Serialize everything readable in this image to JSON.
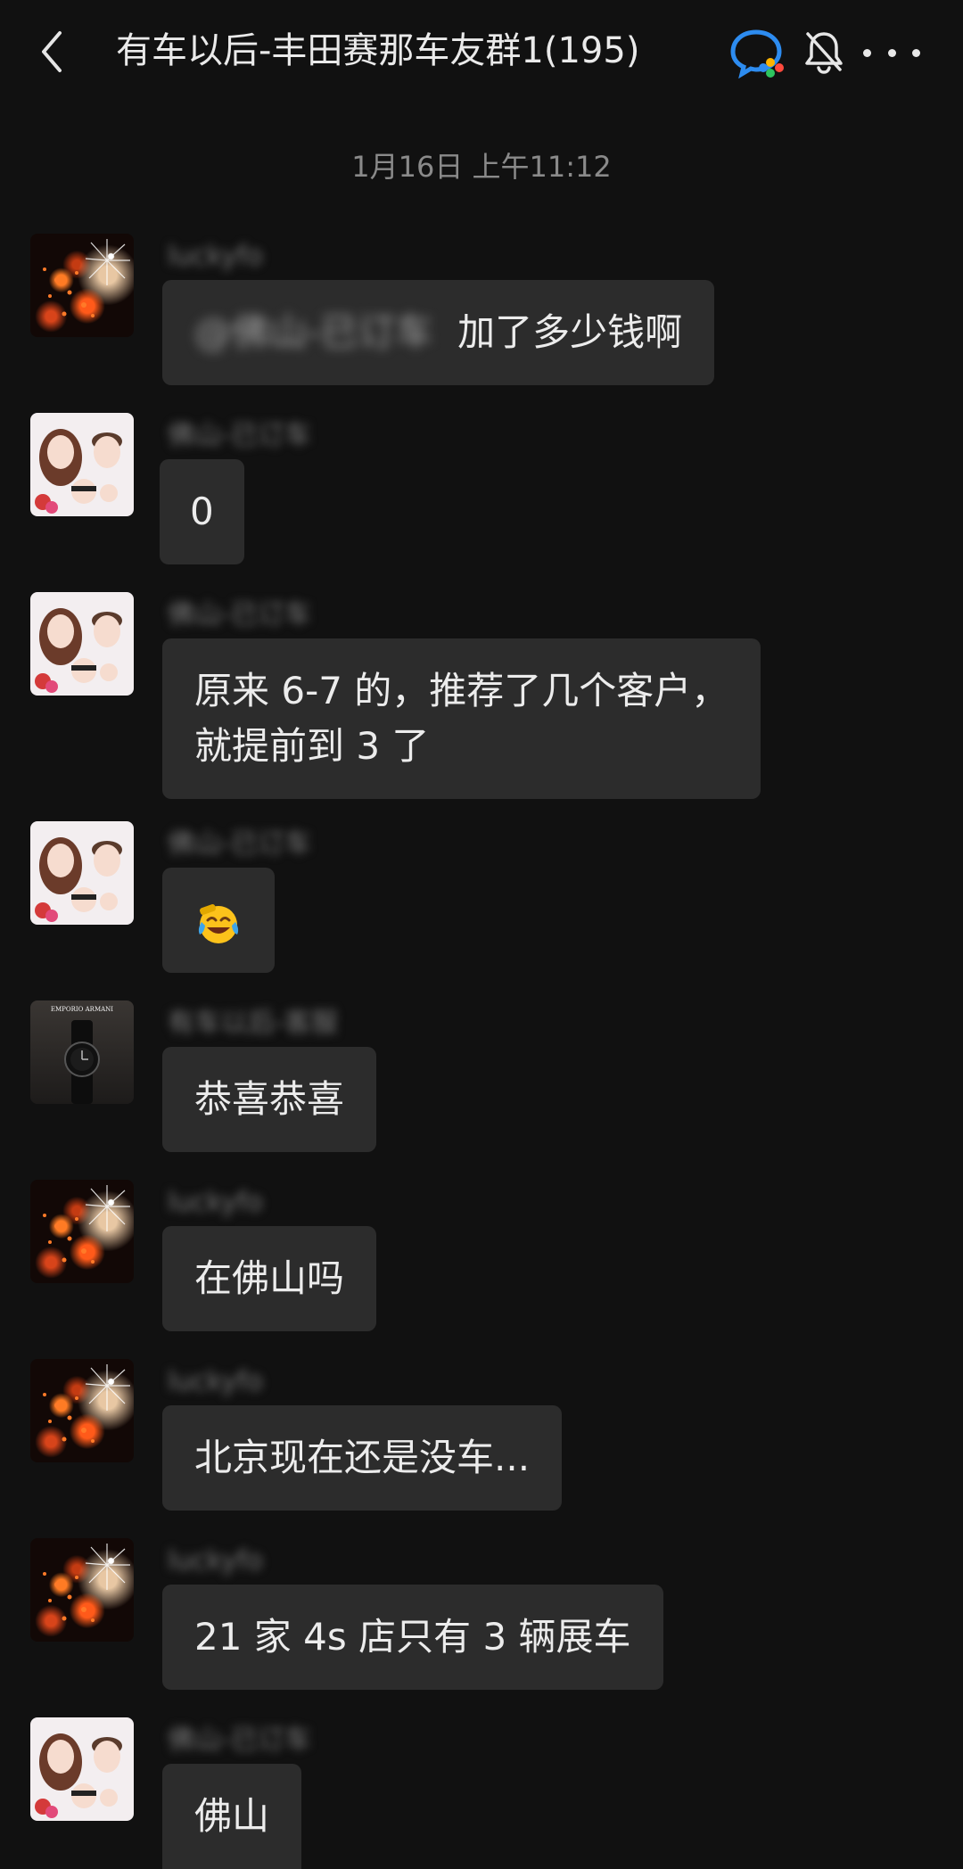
{
  "header": {
    "back_icon": "chevron-left-icon",
    "title": "有车以后-丰田赛那车友群1(195)",
    "corp_icon": "enterprise-chat-icon",
    "mute_icon": "bell-off-icon",
    "more_icon": "more-dots-icon"
  },
  "divider": {
    "time": "1月16日 上午11:12"
  },
  "messages": [
    {
      "sender": "luckyfo",
      "avatar": "fireworks-avatar",
      "mention": "@佛山-已订车",
      "text": "加了多少钱啊"
    },
    {
      "sender": "佛山-已订车",
      "avatar": "couple-avatar",
      "text": "0"
    },
    {
      "sender": "佛山-已订车",
      "avatar": "couple-avatar",
      "text_line1": "原来 6-7 的，推荐了几个客户，",
      "text_line2": "就提前到 3 了"
    },
    {
      "sender": "佛山-已订车",
      "avatar": "couple-avatar",
      "emoji": "face-with-tears-of-joy"
    },
    {
      "sender": "有车以后-客服",
      "avatar": "watch-avatar",
      "text": "恭喜恭喜"
    },
    {
      "sender": "luckyfo",
      "avatar": "fireworks-avatar",
      "text": "在佛山吗"
    },
    {
      "sender": "luckyfo",
      "avatar": "fireworks-avatar",
      "text": "北京现在还是没车..."
    },
    {
      "sender": "luckyfo",
      "avatar": "fireworks-avatar",
      "text": "21 家 4s 店只有 3 辆展车"
    },
    {
      "sender": "佛山-已订车",
      "avatar": "couple-avatar",
      "text": "佛山"
    }
  ],
  "watch_avatar_brand": "EMPORIO ARMANI",
  "colors": {
    "background": "#111111",
    "bubble": "#2c2c2c",
    "text": "#ececec",
    "muted": "#8a8a8a"
  }
}
